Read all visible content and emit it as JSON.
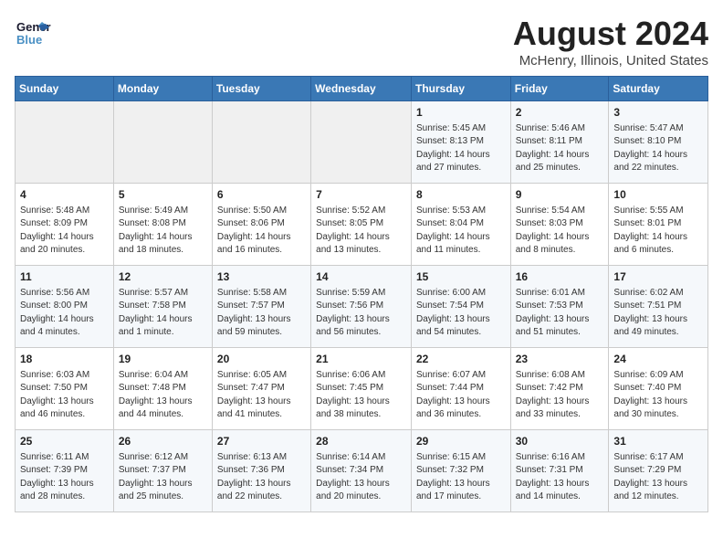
{
  "header": {
    "logo_line1": "General",
    "logo_line2": "Blue",
    "title": "August 2024",
    "subtitle": "McHenry, Illinois, United States"
  },
  "weekdays": [
    "Sunday",
    "Monday",
    "Tuesday",
    "Wednesday",
    "Thursday",
    "Friday",
    "Saturday"
  ],
  "weeks": [
    [
      {
        "day": "",
        "info": ""
      },
      {
        "day": "",
        "info": ""
      },
      {
        "day": "",
        "info": ""
      },
      {
        "day": "",
        "info": ""
      },
      {
        "day": "1",
        "info": "Sunrise: 5:45 AM\nSunset: 8:13 PM\nDaylight: 14 hours\nand 27 minutes."
      },
      {
        "day": "2",
        "info": "Sunrise: 5:46 AM\nSunset: 8:11 PM\nDaylight: 14 hours\nand 25 minutes."
      },
      {
        "day": "3",
        "info": "Sunrise: 5:47 AM\nSunset: 8:10 PM\nDaylight: 14 hours\nand 22 minutes."
      }
    ],
    [
      {
        "day": "4",
        "info": "Sunrise: 5:48 AM\nSunset: 8:09 PM\nDaylight: 14 hours\nand 20 minutes."
      },
      {
        "day": "5",
        "info": "Sunrise: 5:49 AM\nSunset: 8:08 PM\nDaylight: 14 hours\nand 18 minutes."
      },
      {
        "day": "6",
        "info": "Sunrise: 5:50 AM\nSunset: 8:06 PM\nDaylight: 14 hours\nand 16 minutes."
      },
      {
        "day": "7",
        "info": "Sunrise: 5:52 AM\nSunset: 8:05 PM\nDaylight: 14 hours\nand 13 minutes."
      },
      {
        "day": "8",
        "info": "Sunrise: 5:53 AM\nSunset: 8:04 PM\nDaylight: 14 hours\nand 11 minutes."
      },
      {
        "day": "9",
        "info": "Sunrise: 5:54 AM\nSunset: 8:03 PM\nDaylight: 14 hours\nand 8 minutes."
      },
      {
        "day": "10",
        "info": "Sunrise: 5:55 AM\nSunset: 8:01 PM\nDaylight: 14 hours\nand 6 minutes."
      }
    ],
    [
      {
        "day": "11",
        "info": "Sunrise: 5:56 AM\nSunset: 8:00 PM\nDaylight: 14 hours\nand 4 minutes."
      },
      {
        "day": "12",
        "info": "Sunrise: 5:57 AM\nSunset: 7:58 PM\nDaylight: 14 hours\nand 1 minute."
      },
      {
        "day": "13",
        "info": "Sunrise: 5:58 AM\nSunset: 7:57 PM\nDaylight: 13 hours\nand 59 minutes."
      },
      {
        "day": "14",
        "info": "Sunrise: 5:59 AM\nSunset: 7:56 PM\nDaylight: 13 hours\nand 56 minutes."
      },
      {
        "day": "15",
        "info": "Sunrise: 6:00 AM\nSunset: 7:54 PM\nDaylight: 13 hours\nand 54 minutes."
      },
      {
        "day": "16",
        "info": "Sunrise: 6:01 AM\nSunset: 7:53 PM\nDaylight: 13 hours\nand 51 minutes."
      },
      {
        "day": "17",
        "info": "Sunrise: 6:02 AM\nSunset: 7:51 PM\nDaylight: 13 hours\nand 49 minutes."
      }
    ],
    [
      {
        "day": "18",
        "info": "Sunrise: 6:03 AM\nSunset: 7:50 PM\nDaylight: 13 hours\nand 46 minutes."
      },
      {
        "day": "19",
        "info": "Sunrise: 6:04 AM\nSunset: 7:48 PM\nDaylight: 13 hours\nand 44 minutes."
      },
      {
        "day": "20",
        "info": "Sunrise: 6:05 AM\nSunset: 7:47 PM\nDaylight: 13 hours\nand 41 minutes."
      },
      {
        "day": "21",
        "info": "Sunrise: 6:06 AM\nSunset: 7:45 PM\nDaylight: 13 hours\nand 38 minutes."
      },
      {
        "day": "22",
        "info": "Sunrise: 6:07 AM\nSunset: 7:44 PM\nDaylight: 13 hours\nand 36 minutes."
      },
      {
        "day": "23",
        "info": "Sunrise: 6:08 AM\nSunset: 7:42 PM\nDaylight: 13 hours\nand 33 minutes."
      },
      {
        "day": "24",
        "info": "Sunrise: 6:09 AM\nSunset: 7:40 PM\nDaylight: 13 hours\nand 30 minutes."
      }
    ],
    [
      {
        "day": "25",
        "info": "Sunrise: 6:11 AM\nSunset: 7:39 PM\nDaylight: 13 hours\nand 28 minutes."
      },
      {
        "day": "26",
        "info": "Sunrise: 6:12 AM\nSunset: 7:37 PM\nDaylight: 13 hours\nand 25 minutes."
      },
      {
        "day": "27",
        "info": "Sunrise: 6:13 AM\nSunset: 7:36 PM\nDaylight: 13 hours\nand 22 minutes."
      },
      {
        "day": "28",
        "info": "Sunrise: 6:14 AM\nSunset: 7:34 PM\nDaylight: 13 hours\nand 20 minutes."
      },
      {
        "day": "29",
        "info": "Sunrise: 6:15 AM\nSunset: 7:32 PM\nDaylight: 13 hours\nand 17 minutes."
      },
      {
        "day": "30",
        "info": "Sunrise: 6:16 AM\nSunset: 7:31 PM\nDaylight: 13 hours\nand 14 minutes."
      },
      {
        "day": "31",
        "info": "Sunrise: 6:17 AM\nSunset: 7:29 PM\nDaylight: 13 hours\nand 12 minutes."
      }
    ]
  ]
}
